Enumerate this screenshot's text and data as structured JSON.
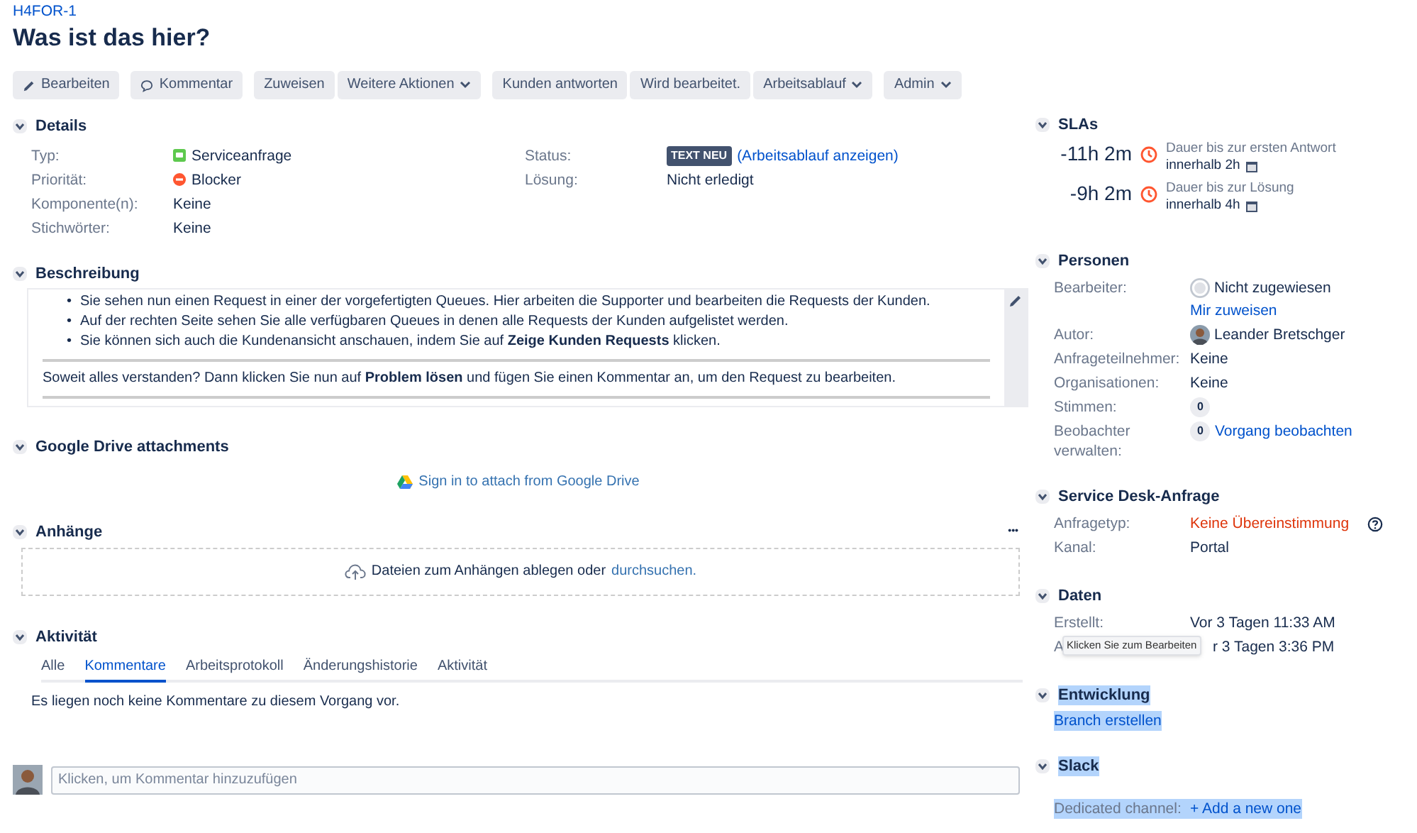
{
  "issue_key": "H4FOR-1",
  "title": "Was ist das hier?",
  "toolbar": [
    {
      "buttons": [
        {
          "label": "Bearbeiten",
          "kind": "edit",
          "dropdown": false
        }
      ]
    },
    {
      "buttons": [
        {
          "label": "Kommentar",
          "kind": "comment",
          "dropdown": false
        }
      ]
    },
    {
      "buttons": [
        {
          "label": "Zuweisen",
          "kind": "plain",
          "dropdown": false
        },
        {
          "label": "Weitere Aktionen",
          "kind": "plain",
          "dropdown": true
        }
      ]
    },
    {
      "buttons": [
        {
          "label": "Kunden antworten",
          "kind": "plain",
          "dropdown": false
        },
        {
          "label": "Wird bearbeitet.",
          "kind": "plain",
          "dropdown": false
        },
        {
          "label": "Arbeitsablauf",
          "kind": "plain",
          "dropdown": true
        }
      ]
    },
    {
      "buttons": [
        {
          "label": "Admin",
          "kind": "plain",
          "dropdown": true
        }
      ]
    }
  ],
  "details": {
    "title": "Details",
    "expanded": true,
    "left": [
      {
        "label": "Typ:",
        "value": "Serviceanfrage",
        "kind": "type"
      },
      {
        "label": "Priorität:",
        "value": "Blocker",
        "kind": "priority"
      },
      {
        "label": "Komponente(n):",
        "value": "Keine",
        "kind": "text"
      },
      {
        "label": "Stichwörter:",
        "value": "Keine",
        "kind": "text"
      }
    ],
    "right": [
      {
        "label": "Status:",
        "badge": "TEXT NEU",
        "link": "(Arbeitsablauf anzeigen)",
        "kind": "status"
      },
      {
        "label": "Lösung:",
        "value": "Nicht erledigt",
        "kind": "text"
      }
    ]
  },
  "description": {
    "title": "Beschreibung",
    "expanded": true,
    "marker": "•",
    "bullets": [
      "Sie sehen nun einen Request in einer der vorgefertigten Queues. Hier arbeiten die Supporter und bearbeiten die Requests der Kunden.",
      "Auf der rechten Seite sehen Sie alle verfügbaren Queues in denen alle Requests der Kunden aufgelistet werden.",
      "Sie können sich auch die Kundenansicht anschauen, indem Sie auf **Zeige Kunden Requests** klicken."
    ],
    "paragraph": "Soweit alles verstanden? Dann klicken Sie nun auf **Problem lösen** und fügen Sie einen Kommentar an, um den Request zu bearbeiten."
  },
  "google_drive": {
    "title": "Google Drive attachments",
    "expanded": true,
    "link": "Sign in to attach from Google Drive"
  },
  "attachments": {
    "title": "Anhänge",
    "expanded": true,
    "more": "•••",
    "drop_text": "Dateien zum Anhängen ablegen oder",
    "browse_link": "durchsuchen."
  },
  "activity": {
    "title": "Aktivität",
    "expanded": true,
    "tabs": [
      {
        "label": "Alle",
        "selected": false
      },
      {
        "label": "Kommentare",
        "selected": true
      },
      {
        "label": "Arbeitsprotokoll",
        "selected": false
      },
      {
        "label": "Änderungshistorie",
        "selected": false
      },
      {
        "label": "Aktivität",
        "selected": false
      }
    ],
    "empty_text": "Es liegen noch keine Kommentare zu diesem Vorgang vor.",
    "comment_placeholder": "Klicken, um Kommentar hinzuzufügen"
  },
  "slas": {
    "title": "SLAs",
    "expanded": true,
    "items": [
      {
        "time": "-11h 2m",
        "goal": "Dauer bis zur ersten Antwort",
        "within": "innerhalb 2h"
      },
      {
        "time": "-9h 2m",
        "goal": "Dauer bis zur Lösung",
        "within": "innerhalb 4h"
      }
    ]
  },
  "people": {
    "title": "Personen",
    "expanded": true,
    "rows": [
      {
        "label": "Bearbeiter:",
        "value": "Nicht zugewiesen",
        "kind": "unassigned",
        "link": "Mir zuweisen"
      },
      {
        "label": "Autor:",
        "value": "Leander Bretschger",
        "kind": "avatar"
      },
      {
        "label": "Anfrageteilnehmer:",
        "value": "Keine",
        "kind": "text"
      },
      {
        "label": "Organisationen:",
        "value": "Keine",
        "kind": "text"
      },
      {
        "label": "Stimmen:",
        "count": "0",
        "kind": "count"
      },
      {
        "label": "Beobachter verwalten:",
        "count": "0",
        "link": "Vorgang beobachten",
        "kind": "count"
      }
    ]
  },
  "service_desk": {
    "title": "Service Desk-Anfrage",
    "expanded": true,
    "rows": [
      {
        "label": "Anfragetyp:",
        "value": "Keine Übereinstimmung",
        "kind": "error"
      },
      {
        "label": "Kanal:",
        "value": "Portal",
        "kind": "text"
      }
    ]
  },
  "dates": {
    "title": "Daten",
    "expanded": true,
    "rows": [
      {
        "label": "Erstellt:",
        "value": "Vor 3 Tagen 11:33 AM"
      },
      {
        "label": "A",
        "value": "r 3 Tagen 3:36 PM"
      }
    ],
    "tooltip": "Klicken Sie zum Bearbeiten"
  },
  "development": {
    "title": "Entwicklung",
    "expanded": true,
    "highlighted": true,
    "link": "Branch erstellen"
  },
  "slack": {
    "title": "Slack",
    "expanded": true,
    "highlighted": true,
    "label": "Dedicated channel:",
    "link": "+ Add a new one"
  }
}
